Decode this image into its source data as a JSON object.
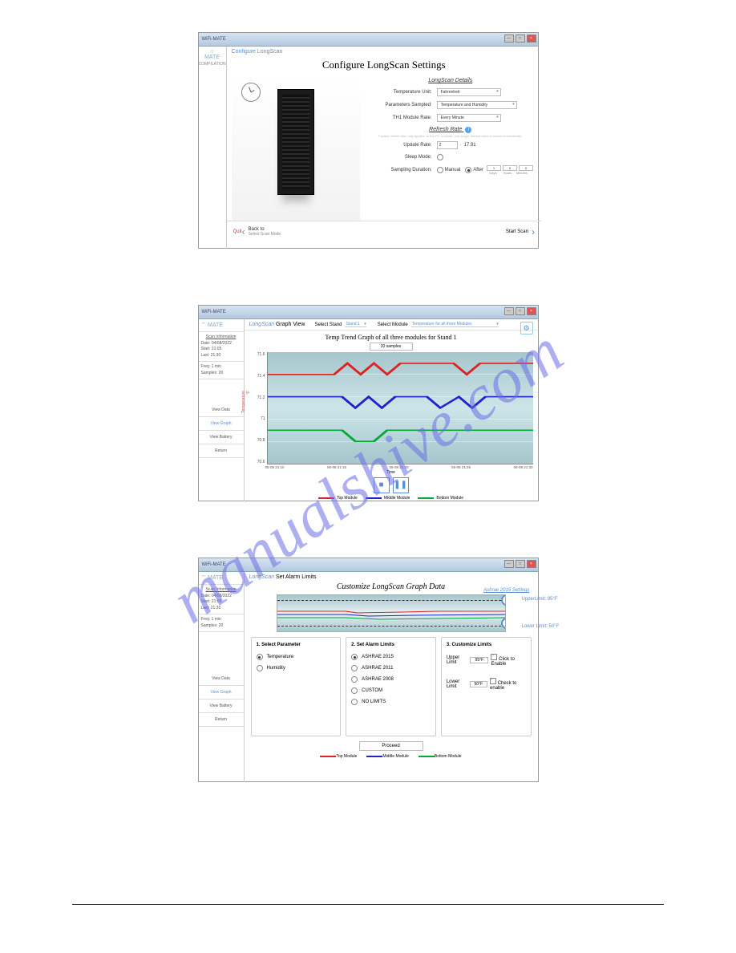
{
  "watermark": "manualshive.com",
  "window": {
    "title": "WiFi-MATE",
    "logo": "MATE",
    "logo_sub": "COMPILATION"
  },
  "s1": {
    "breadcrumb": "Configure LongScan",
    "title": "Configure LongScan Settings",
    "section1": "LongScan Details",
    "temp_label": "Temperature Unit:",
    "temp_val": "Fahrenheit",
    "params_label": "Parameters Sampled:",
    "params_val": "Temperature and Humidity",
    "rate_label": "TH1 Module Rate:",
    "rate_val": "Every Minute",
    "section2": "Refresh Rate",
    "help": "Fastest refresh time only applies on the PC or tablet. Use longer refresh rates to conserve bandwidth.",
    "update_label": "Update Rate:",
    "update_val": "2",
    "update_unit": "17.91",
    "sleep_label": "Sleep Mode:",
    "sampling_label": "Sampling Duration:",
    "manual": "Manual",
    "after": "After",
    "d_val": "1",
    "d_lab": "Days",
    "h_val": "0",
    "h_lab": "Hours",
    "m_val": "0",
    "m_lab": "Minutes",
    "quit": "Quit",
    "back": "Back to",
    "back_sub": "Select Scan Mode",
    "start": "Start Scan"
  },
  "s2": {
    "title_prefix": "LongScan",
    "title_mode": "Graph View",
    "sel_stand_lab": "Select Stand",
    "sel_stand_val": "Stand 1",
    "sel_mod_lab": "Select Module",
    "sel_mod_val": "Temperature for all three Modules",
    "sidebar": {
      "scan_info": "Scan Information",
      "date_lab": "Date:",
      "date_val": "04/08/2022",
      "start_lab": "Start:",
      "start_val": "21:05",
      "last_lab": "Last:",
      "last_val": "21:30",
      "freq_lab": "Freq:",
      "freq_val": "1 min",
      "samples_lab": "Samples:",
      "samples_val": "20",
      "btn1": "View Data",
      "btn2": "View Graph",
      "btn3": "View Battery",
      "btn4": "Return"
    },
    "chart_title": "Temp Trend Graph of all three modules for Stand 1",
    "badge": "20 samples",
    "ylabel": "Temperature °F",
    "xlabel": "Time",
    "legend": {
      "top": "Top Module",
      "mid": "Middle Module",
      "bot": "Bottom Module"
    },
    "yTicks": [
      "71.6",
      "71.4",
      "71.2",
      "71",
      "70.8",
      "70.6"
    ],
    "xTicks": [
      "06-08 21:10",
      "06-08 21:15",
      "06-08 21:20",
      "06-08 21:25",
      "06-08 21:30"
    ]
  },
  "s3": {
    "title_prefix": "LongScan",
    "title_mode": "Set Alarm Limits",
    "heading": "Customize LongScan Graph Data",
    "ashrae_link": "Ashrae 2015 Settings",
    "upper": "UpperLimit: 95°F",
    "lower": "Lower Limit: 50°F",
    "panel1": {
      "title": "1. Select Parameter",
      "opt1": "Temperature",
      "opt2": "Humidity"
    },
    "panel2": {
      "title": "2. Set Alarm Limits",
      "o1": "ASHRAE 2015",
      "o2": "ASHRAE 2011",
      "o3": "ASHRAE 2008",
      "o4": "CUSTOM",
      "o5": "NO LIMITS"
    },
    "panel3": {
      "title": "3. Customize Limits",
      "ul_lab": "Upper Limit",
      "ul_val": "95°F",
      "ul_chk": "Click to Enable",
      "ll_lab": "Lower Limit",
      "ll_val": "50°F",
      "ll_chk": "Check to enable"
    },
    "proceed": "Proceed",
    "legend": {
      "top": "Top Module",
      "mid": "Middle Module",
      "bot": "Bottom Module"
    }
  },
  "chart_data": {
    "type": "line",
    "title": "Temp Trend Graph of all three modules for Stand 1",
    "xlabel": "Time",
    "ylabel": "Temperature °F",
    "ylim": [
      70.6,
      71.6
    ],
    "x": [
      "06-08 21:10",
      "06-08 21:11",
      "06-08 21:12",
      "06-08 21:13",
      "06-08 21:14",
      "06-08 21:15",
      "06-08 21:16",
      "06-08 21:17",
      "06-08 21:18",
      "06-08 21:19",
      "06-08 21:20",
      "06-08 21:21",
      "06-08 21:22",
      "06-08 21:23",
      "06-08 21:24",
      "06-08 21:25",
      "06-08 21:26",
      "06-08 21:27",
      "06-08 21:28",
      "06-08 21:29"
    ],
    "series": [
      {
        "name": "Top Module",
        "color": "#d22",
        "values": [
          71.4,
          71.4,
          71.4,
          71.4,
          71.4,
          71.5,
          71.4,
          71.5,
          71.4,
          71.5,
          71.5,
          71.5,
          71.5,
          71.5,
          71.5,
          71.4,
          71.5,
          71.5,
          71.5,
          71.5
        ]
      },
      {
        "name": "Middle Module",
        "color": "#22c",
        "values": [
          71.2,
          71.2,
          71.2,
          71.2,
          71.2,
          71.2,
          71.1,
          71.2,
          71.1,
          71.2,
          71.2,
          71.2,
          71.2,
          71.1,
          71.2,
          71.1,
          71.2,
          71.2,
          71.2,
          71.2
        ]
      },
      {
        "name": "Bottom Module",
        "color": "#0a3",
        "values": [
          70.9,
          70.9,
          70.9,
          70.9,
          70.9,
          70.9,
          70.8,
          70.8,
          70.9,
          70.9,
          70.9,
          70.9,
          70.9,
          70.9,
          70.9,
          70.9,
          70.9,
          70.9,
          70.9,
          70.9
        ]
      }
    ]
  }
}
